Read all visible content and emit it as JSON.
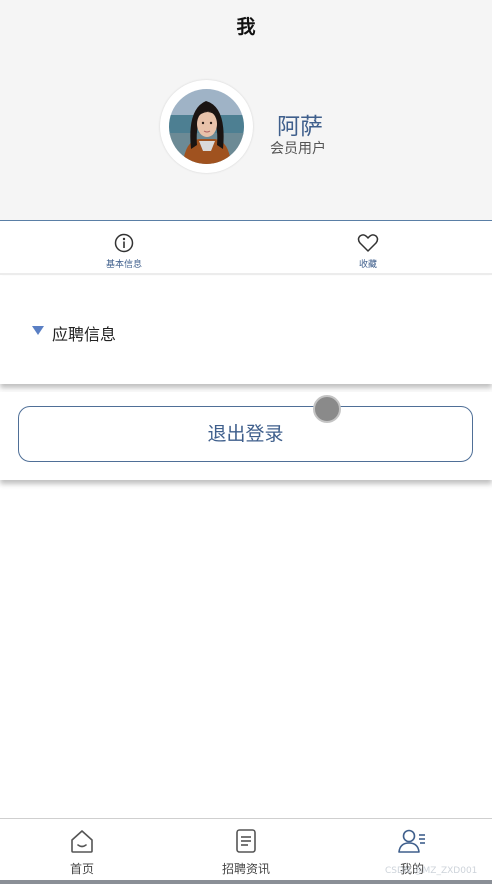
{
  "header": {
    "title": "我"
  },
  "profile": {
    "name": "阿萨",
    "role": "会员用户"
  },
  "tabs": [
    {
      "label": "基本信息",
      "icon": "info-icon"
    },
    {
      "label": "收藏",
      "icon": "heart-icon"
    }
  ],
  "section": {
    "title": "应聘信息"
  },
  "logout": {
    "label": "退出登录"
  },
  "bottom_nav": [
    {
      "label": "首页",
      "icon": "home-icon"
    },
    {
      "label": "招聘资讯",
      "icon": "document-icon"
    },
    {
      "label": "我的",
      "icon": "user-icon",
      "active": true
    }
  ],
  "watermark": "CSDN @MZ_ZXD001",
  "colors": {
    "accent": "#3f5f8c",
    "triangle": "#5a7fc4",
    "header_bg": "#f5f5f5"
  }
}
